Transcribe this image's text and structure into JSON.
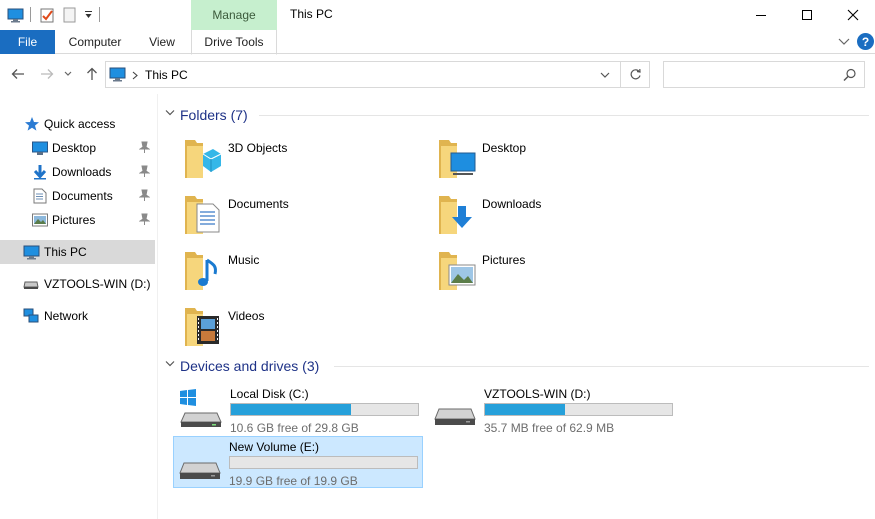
{
  "window": {
    "title": "This PC",
    "context_tab": "Manage"
  },
  "ribbon": {
    "tabs": [
      "File",
      "Computer",
      "View",
      "Drive Tools"
    ],
    "help_label": "?"
  },
  "address": {
    "location": "This PC",
    "search_placeholder": ""
  },
  "sidebar": {
    "quick_access": "Quick access",
    "pinned": [
      {
        "label": "Desktop",
        "icon": "desktop-icon"
      },
      {
        "label": "Downloads",
        "icon": "downloads-icon"
      },
      {
        "label": "Documents",
        "icon": "documents-icon"
      },
      {
        "label": "Pictures",
        "icon": "pictures-icon"
      }
    ],
    "this_pc": "This PC",
    "drive": "VZTOOLS-WIN (D:)",
    "network": "Network"
  },
  "folders": {
    "header": "Folders (7)",
    "items": [
      {
        "name": "3D Objects",
        "icon": "3d-objects-icon"
      },
      {
        "name": "Desktop",
        "icon": "desktop-icon"
      },
      {
        "name": "Documents",
        "icon": "documents-icon"
      },
      {
        "name": "Downloads",
        "icon": "downloads-icon"
      },
      {
        "name": "Music",
        "icon": "music-icon"
      },
      {
        "name": "Pictures",
        "icon": "pictures-icon"
      },
      {
        "name": "Videos",
        "icon": "videos-icon"
      }
    ]
  },
  "drives": {
    "header": "Devices and drives (3)",
    "items": [
      {
        "name": "Local Disk (C:)",
        "free": "10.6 GB free of 29.8 GB",
        "used_fraction": 0.64,
        "selected": false
      },
      {
        "name": "VZTOOLS-WIN (D:)",
        "free": "35.7 MB free of 62.9 MB",
        "used_fraction": 0.43,
        "selected": false
      },
      {
        "name": "New Volume (E:)",
        "free": "19.9 GB free of 19.9 GB",
        "used_fraction": 0.0,
        "selected": true
      }
    ]
  },
  "colors": {
    "accent": "#1a6dc1",
    "header_text": "#1e3287",
    "context_tab": "#c6efce",
    "selection": "#cce8ff",
    "drive_bar": "#26a0da"
  }
}
